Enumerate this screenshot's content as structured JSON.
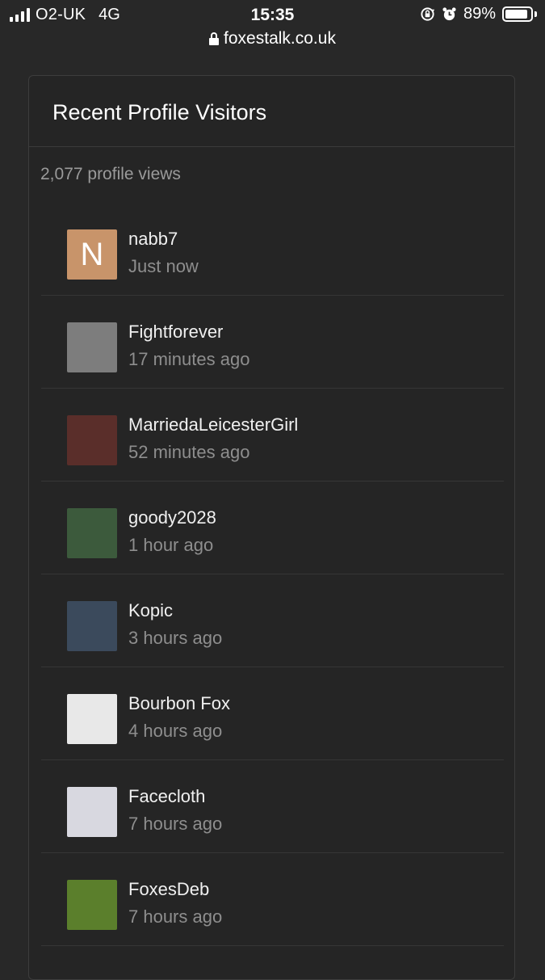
{
  "status_bar": {
    "carrier": "O2-UK",
    "network": "4G",
    "time": "15:35",
    "battery": "89%",
    "battery_level": 0.89,
    "icons": [
      "signal-icon",
      "orientation-lock-icon",
      "alarm-icon",
      "battery-icon"
    ]
  },
  "browser": {
    "url": "foxestalk.co.uk",
    "icon": "lock-icon"
  },
  "panel": {
    "title": "Recent Profile Visitors",
    "views": "2,077 profile views"
  },
  "visitors": [
    {
      "name": "nabb7",
      "time": "Just now",
      "avatar_letter": "N",
      "avatar_color": "#c8946a"
    },
    {
      "name": "Fightforever",
      "time": "17 minutes ago",
      "avatar_letter": "",
      "avatar_color": "#7d7d7d"
    },
    {
      "name": "MarriedaLeicesterGirl",
      "time": "52 minutes ago",
      "avatar_letter": "",
      "avatar_color": "#5a2e2a"
    },
    {
      "name": "goody2028",
      "time": "1 hour ago",
      "avatar_letter": "",
      "avatar_color": "#3c5a3c"
    },
    {
      "name": "Kopic",
      "time": "3 hours ago",
      "avatar_letter": "",
      "avatar_color": "#3b4a5c"
    },
    {
      "name": "Bourbon Fox",
      "time": "4 hours ago",
      "avatar_letter": "",
      "avatar_color": "#e8e8e8"
    },
    {
      "name": "Facecloth",
      "time": "7 hours ago",
      "avatar_letter": "",
      "avatar_color": "#d8d8e0"
    },
    {
      "name": "FoxesDeb",
      "time": "7 hours ago",
      "avatar_letter": "",
      "avatar_color": "#5b7f2c"
    }
  ]
}
